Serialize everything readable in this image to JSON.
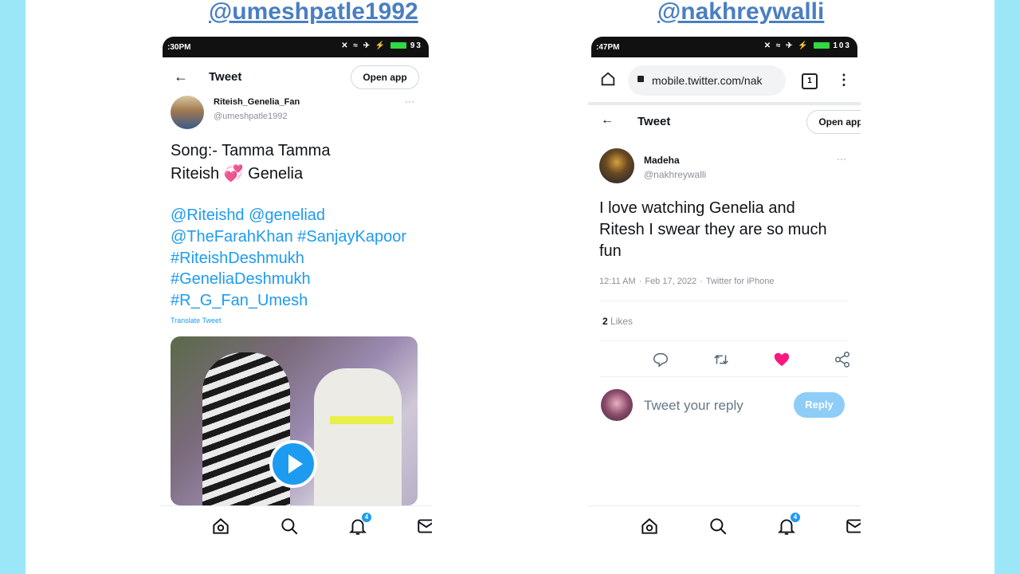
{
  "left": {
    "handle": "@umeshpatle1992",
    "status_time": ":30PM",
    "status_icons": "✕ ≈ ✈ ⚡",
    "status_battery": "93",
    "header_title": "Tweet",
    "open_app": "Open app",
    "author_name": "Riteish_Genelia_Fan",
    "author_handle": "@umeshpatle1992",
    "more": "···",
    "text_line1": "Song:- Tamma Tamma",
    "text_line2": "Riteish 💞 Genelia",
    "mentions": [
      "@Riteishd @geneliad",
      "@TheFarahKhan #SanjayKapoor",
      "#RiteishDeshmukh",
      "#GeneliaDeshmukh",
      "#R_G_Fan_Umesh"
    ],
    "translate": "Translate Tweet",
    "notif_badge": "4",
    "nav_icons": [
      "home-icon",
      "search-icon",
      "bell-icon",
      "mail-icon"
    ]
  },
  "right": {
    "handle": "@nakhreywalli",
    "status_time": ":47PM",
    "status_icons": "✕ ≈ ✈ ⚡",
    "status_battery": "103",
    "url": "mobile.twitter.com/nak",
    "tab_count": "1",
    "header_title": "Tweet",
    "open_app": "Open app",
    "author_name": "Madeha",
    "author_handle": "@nakhreywalli",
    "more": "···",
    "text": [
      "I love watching Genelia and",
      "Ritesh I swear they are so much",
      "fun"
    ],
    "time": "12:11 AM",
    "date": "Feb 17, 2022",
    "source": "Twitter for iPhone",
    "likes_count": "2",
    "likes_label": "Likes",
    "reply_placeholder": "Tweet your reply",
    "reply_button": "Reply",
    "notif_badge": "4"
  },
  "colors": {
    "background": "#9be7f7",
    "handle": "#4a7fc1",
    "link": "#1d9bf0",
    "like": "#f91880"
  }
}
